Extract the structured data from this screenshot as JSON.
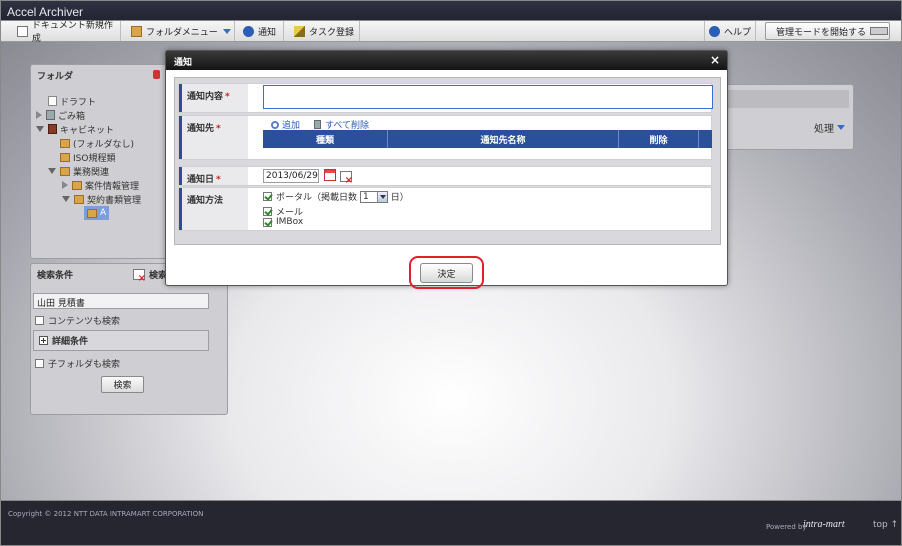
{
  "app": {
    "title": "Accel Archiver"
  },
  "toolbar": {
    "new_doc": "ドキュメント新規作成",
    "folder_menu": "フォルダメニュー",
    "notify": "通知",
    "task": "タスク登録",
    "help": "ヘルプ",
    "admin_mode": "管理モードを開始する"
  },
  "folder_panel": {
    "title": "フォルダ",
    "items": [
      {
        "label": "ドラフト"
      },
      {
        "label": "ごみ箱"
      },
      {
        "label": "キャビネット"
      },
      {
        "label": "(フォルダなし)"
      },
      {
        "label": "ISO規程類"
      },
      {
        "label": "業務関連"
      },
      {
        "label": "案件情報管理"
      },
      {
        "label": "契約書類管理"
      },
      {
        "label": "A"
      }
    ]
  },
  "search_panel": {
    "title": "検索条件",
    "clear_label": "検索",
    "keyword": "山田 見積書",
    "content_search": "コンテンツも検索",
    "detail": "詳細条件",
    "subfolder_search": "子フォルダも検索",
    "search_button": "検索"
  },
  "main_bg": {
    "action": "処理"
  },
  "modal": {
    "title": "通知",
    "content_label": "通知内容",
    "req_mark": "*",
    "content_value": "",
    "dest_label": "通知先",
    "add_link": "追加",
    "delete_all_link": "すべて削除",
    "table_headers": [
      "種類",
      "通知先名称",
      "削除"
    ],
    "date_label": "通知日",
    "date_value": "2013/06/29",
    "method_label": "通知方法",
    "portal_label": "ポータル（掲載日数",
    "days_value": "1",
    "days_suffix": "日）",
    "mail_label": "メール",
    "imbox_label": "IMBox",
    "confirm": "決定"
  },
  "footer": {
    "copyright": "Copyright © 2012 NTT DATA INTRAMART CORPORATION",
    "powered": "Powered by",
    "brand": "intra-mart",
    "top": "top ↑"
  }
}
